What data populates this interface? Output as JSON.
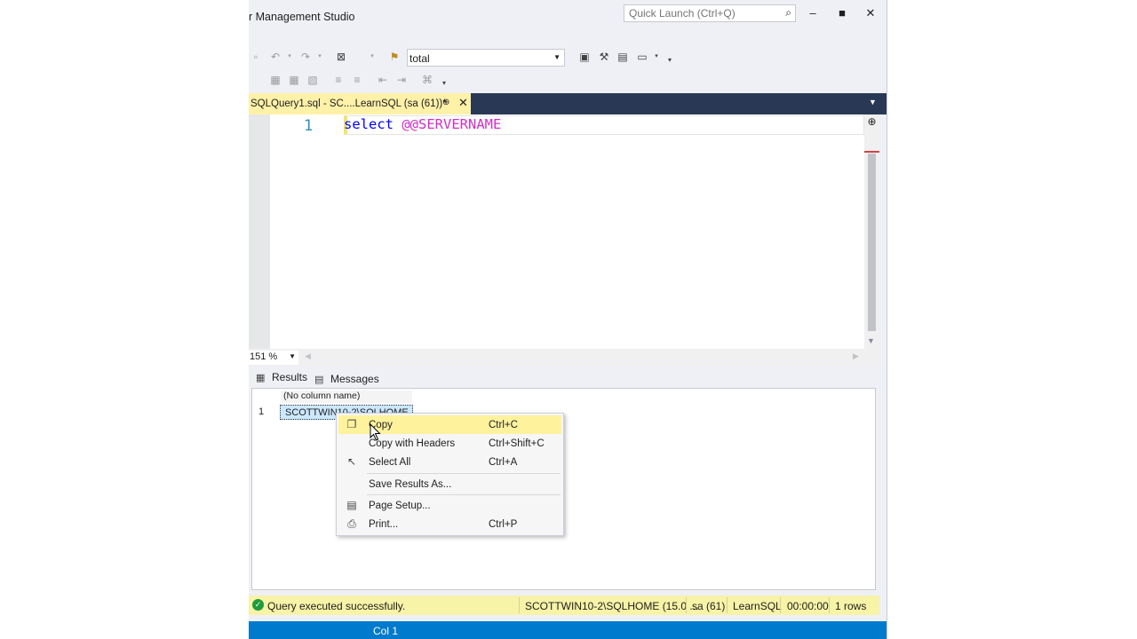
{
  "window": {
    "title": "r Management Studio",
    "quick_launch_placeholder": "Quick Launch (Ctrl+Q)"
  },
  "toolbar": {
    "database_combo": "total"
  },
  "document_tab": {
    "label": "SQLQuery1.sql - SC....LearnSQL (sa (61))*"
  },
  "editor": {
    "line_number": "1",
    "code_keyword": "select",
    "code_function": "@@SERVERNAME",
    "zoom": "151 %"
  },
  "results": {
    "tabs": [
      "Results",
      "Messages"
    ],
    "column_header": "(No column name)",
    "row_number": "1",
    "cell_value": "SCOTTWIN10-2\\SQLHOME"
  },
  "context_menu": {
    "items": [
      {
        "label": "Copy",
        "shortcut": "Ctrl+C"
      },
      {
        "label": "Copy with Headers",
        "shortcut": "Ctrl+Shift+C"
      },
      {
        "label": "Select All",
        "shortcut": "Ctrl+A"
      },
      {
        "label": "Save Results As...",
        "shortcut": ""
      },
      {
        "label": "Page Setup...",
        "shortcut": ""
      },
      {
        "label": "Print...",
        "shortcut": "Ctrl+P"
      }
    ]
  },
  "status_bar": {
    "message": "Query executed successfully.",
    "server": "SCOTTWIN10-2\\SQLHOME (15.0 ...",
    "user": "sa (61)",
    "database": "LearnSQL",
    "elapsed": "00:00:00",
    "rows": "1 rows"
  },
  "bottom_bar": {
    "column": "Col 1"
  },
  "colors": {
    "tab_active": "#fff1a8",
    "tabstrip": "#293955",
    "status_bar": "#f7f3a7",
    "bottom_bar": "#007acc",
    "menu_highlight": "#fff29d",
    "selection": "#cce8ff"
  }
}
